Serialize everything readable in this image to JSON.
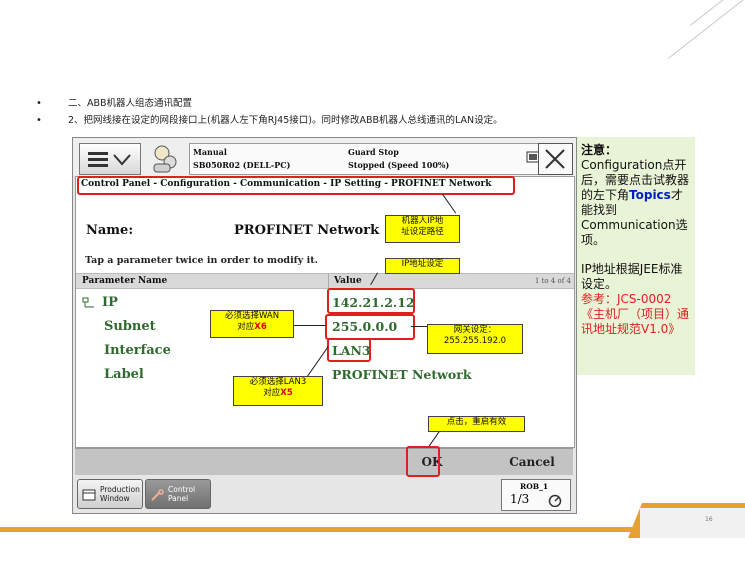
{
  "slide": {
    "bullets": [
      "二、ABB机器人组态通讯配置",
      "2、把网线接在设定的网段接口上(机器人左下角RJ45接口)。同时修改ABB机器人总线通讯的LAN设定。"
    ],
    "page_number": "16",
    "accent_color": "#e8a030"
  },
  "pendant": {
    "status": {
      "mode": "Manual",
      "controller": "SB050R02 (DELL-PC)",
      "state": "Guard Stop",
      "detail": "Stopped (Speed 100%)"
    },
    "breadcrumb": "Control Panel - Configuration - Communication - IP Setting - PROFINET Network",
    "name_label": "Name:",
    "name_value": "PROFINET Network",
    "hint": "Tap a parameter twice in order to modify it.",
    "table": {
      "col_name": "Parameter Name",
      "col_value": "Value",
      "count": "1 to 4 of 4",
      "rows": [
        {
          "name": "IP",
          "value": "142.21.2.12"
        },
        {
          "name": "Subnet",
          "value": "255.0.0.0"
        },
        {
          "name": "Interface",
          "value": "LAN3"
        },
        {
          "name": "Label",
          "value": "PROFINET Network"
        }
      ]
    },
    "ok_label": "OK",
    "cancel_label": "Cancel",
    "taskbar": {
      "production_window": "Production\nWindow",
      "control_panel": "Control\nPanel",
      "rob_name": "ROB_1",
      "rob_fraction": "1/3"
    }
  },
  "callouts": {
    "path": "机器人IP地\n址设定路径",
    "ip": "IP地址设定",
    "wan_text": "必须选择WAN\n对应",
    "wan_port": "X6",
    "lan3_text": "必须选择LAN3\n对应",
    "lan3_port": "X5",
    "gateway": "网关设定：\n255.255.192.0",
    "restart": "点击，重启有效"
  },
  "note": {
    "title": "注意：",
    "line1a": "Configuration点开后，需要点击试教器的左下角",
    "topics": "Topics",
    "line1b": "才能找到Communication选项。",
    "line2": "IP地址根据JEE标准设定。",
    "ref": "参考：JCS-0002《主机厂（项目）通讯地址规范V1.0》"
  }
}
